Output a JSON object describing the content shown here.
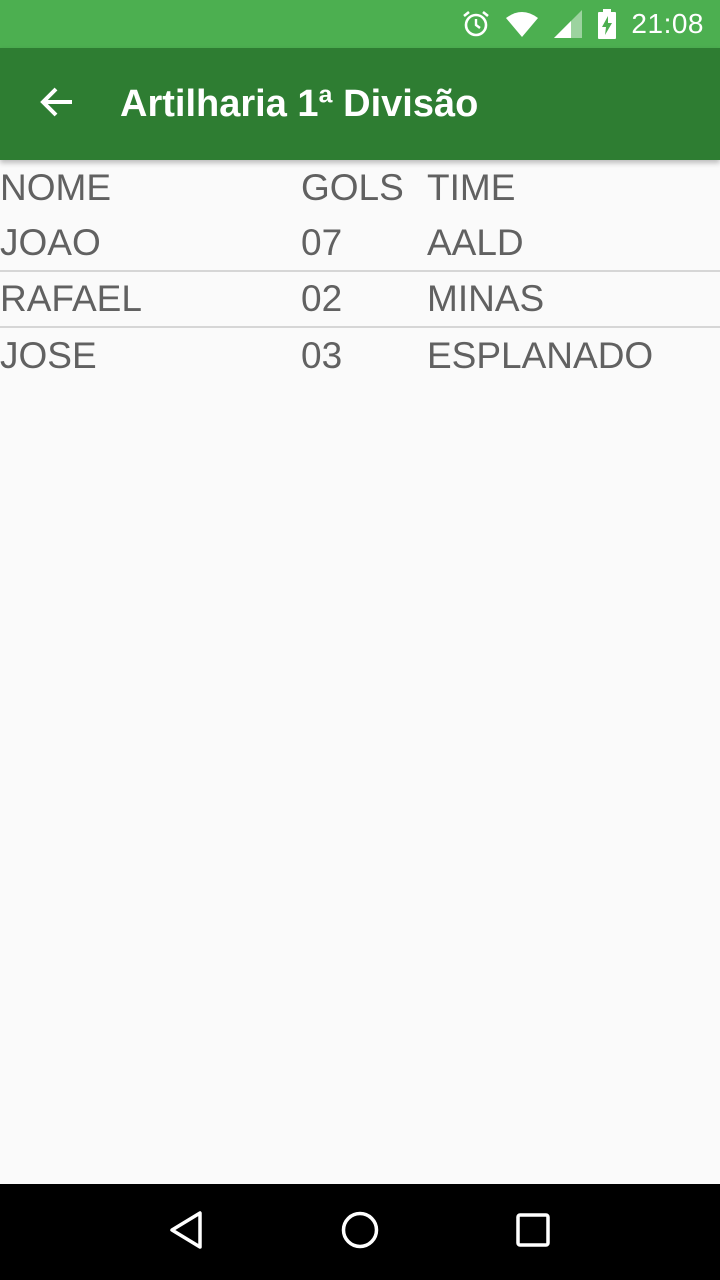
{
  "status_bar": {
    "time": "21:08",
    "icons": [
      "alarm-icon",
      "wifi-icon",
      "signal-icon",
      "battery-charging-icon"
    ]
  },
  "app_bar": {
    "back_icon": "arrow-back-icon",
    "title": "Artilharia 1ª Divisão"
  },
  "table": {
    "headers": {
      "nome": "NOME",
      "gols": "GOLS",
      "time": "TIME"
    },
    "rows": [
      {
        "nome": "JOAO",
        "gols": "07",
        "time": "AALD"
      },
      {
        "nome": "RAFAEL",
        "gols": "02",
        "time": "MINAS"
      },
      {
        "nome": "JOSE",
        "gols": "03",
        "time": "ESPLANADO"
      }
    ]
  },
  "nav_bar": {
    "icons": [
      "back-triangle-icon",
      "home-circle-icon",
      "recents-square-icon"
    ]
  },
  "colors": {
    "status_bar": "#4caf50",
    "app_bar": "#2e7d32",
    "background": "#fafafa",
    "text": "#616161",
    "divider": "#d6d6d6"
  }
}
